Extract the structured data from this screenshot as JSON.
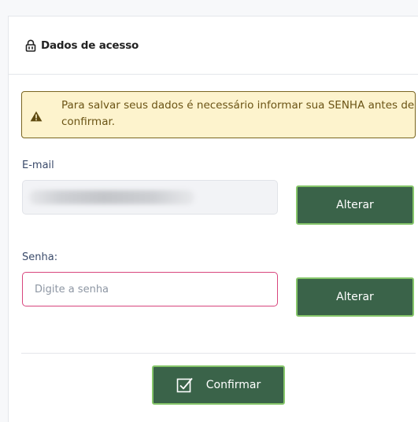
{
  "header": {
    "icon": "lock-icon",
    "title": "Dados de acesso"
  },
  "alert": {
    "icon": "warning-icon",
    "message": "Para salvar seus dados é necessário informar sua SENHA antes de confirmar.",
    "colors": {
      "background": "#fdf3cd",
      "border": "#7a6520",
      "text": "#6b5415"
    }
  },
  "email": {
    "label": "E-mail",
    "value": "",
    "button_label": "Alterar"
  },
  "password": {
    "label": "Senha:",
    "placeholder": "Digite a senha",
    "value": "",
    "button_label": "Alterar"
  },
  "confirm": {
    "icon": "checkbox-check-icon",
    "label": "Confirmar"
  },
  "colors": {
    "button_bg": "#3a6349",
    "button_border": "#86c66a",
    "input_focus_border": "#d8457d"
  }
}
